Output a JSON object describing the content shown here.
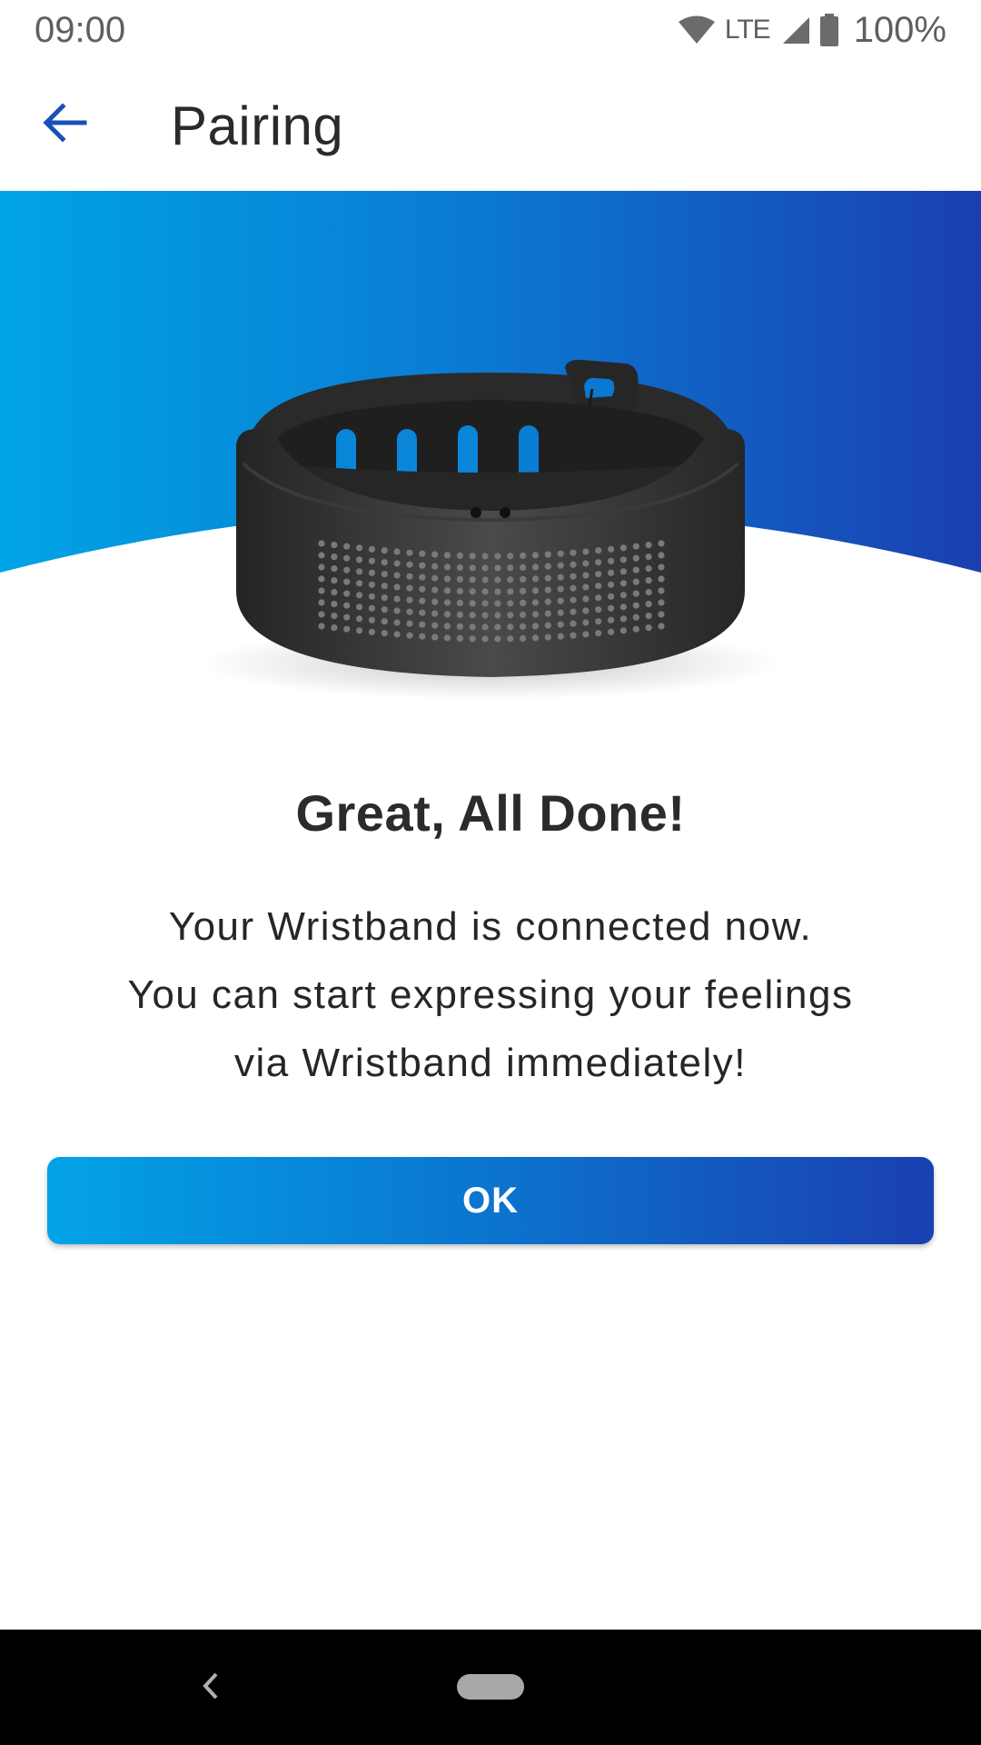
{
  "status_bar": {
    "time": "09:00",
    "network": "LTE",
    "battery": "100%",
    "icons": [
      "wifi-icon",
      "signal-icon",
      "battery-icon"
    ]
  },
  "app_bar": {
    "title": "Pairing",
    "back_icon": "arrow-left-icon"
  },
  "hero": {
    "image": "wristband-illustration",
    "gradient_colors": [
      "#00a0e3",
      "#0b73cf",
      "#1b3fb0"
    ]
  },
  "content": {
    "headline": "Great, All Done!",
    "message_lines": [
      "Your Wristband is connected now.",
      "You can start expressing your feelings",
      "via Wristband immediately!"
    ]
  },
  "actions": {
    "ok_label": "OK"
  },
  "nav_bar": {
    "back_icon": "chevron-left-icon",
    "home_icon": "home-pill-icon"
  },
  "colors": {
    "accent": "#1a4fb8",
    "gradient_start": "#03a3e6",
    "gradient_end": "#1a3fb1"
  }
}
